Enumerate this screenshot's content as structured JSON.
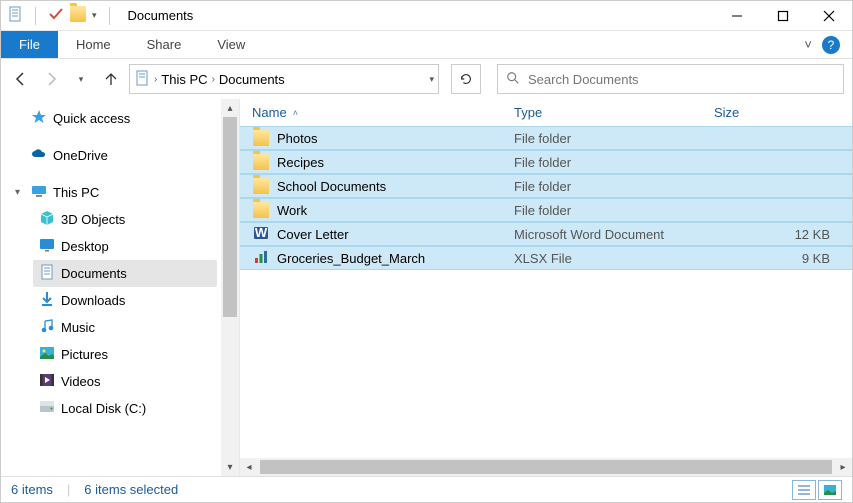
{
  "title": "Documents",
  "ribbon": {
    "file": "File",
    "home": "Home",
    "share": "Share",
    "view": "View"
  },
  "breadcrumb": {
    "root": "This PC",
    "current": "Documents"
  },
  "search": {
    "placeholder": "Search Documents"
  },
  "nav": {
    "quick_access": "Quick access",
    "onedrive": "OneDrive",
    "this_pc": "This PC",
    "items": {
      "3d": "3D Objects",
      "desktop": "Desktop",
      "documents": "Documents",
      "downloads": "Downloads",
      "music": "Music",
      "pictures": "Pictures",
      "videos": "Videos",
      "localdisk": "Local Disk (C:)"
    }
  },
  "columns": {
    "name": "Name",
    "type": "Type",
    "size": "Size"
  },
  "files": [
    {
      "name": "Photos",
      "type": "File folder",
      "size": "",
      "icon": "folder"
    },
    {
      "name": "Recipes",
      "type": "File folder",
      "size": "",
      "icon": "folder"
    },
    {
      "name": "School Documents",
      "type": "File folder",
      "size": "",
      "icon": "folder"
    },
    {
      "name": "Work",
      "type": "File folder",
      "size": "",
      "icon": "folder"
    },
    {
      "name": "Cover Letter",
      "type": "Microsoft Word Document",
      "size": "12 KB",
      "icon": "word"
    },
    {
      "name": "Groceries_Budget_March",
      "type": "XLSX File",
      "size": "9 KB",
      "icon": "xlsx"
    }
  ],
  "status": {
    "items": "6 items",
    "selected": "6 items selected"
  }
}
